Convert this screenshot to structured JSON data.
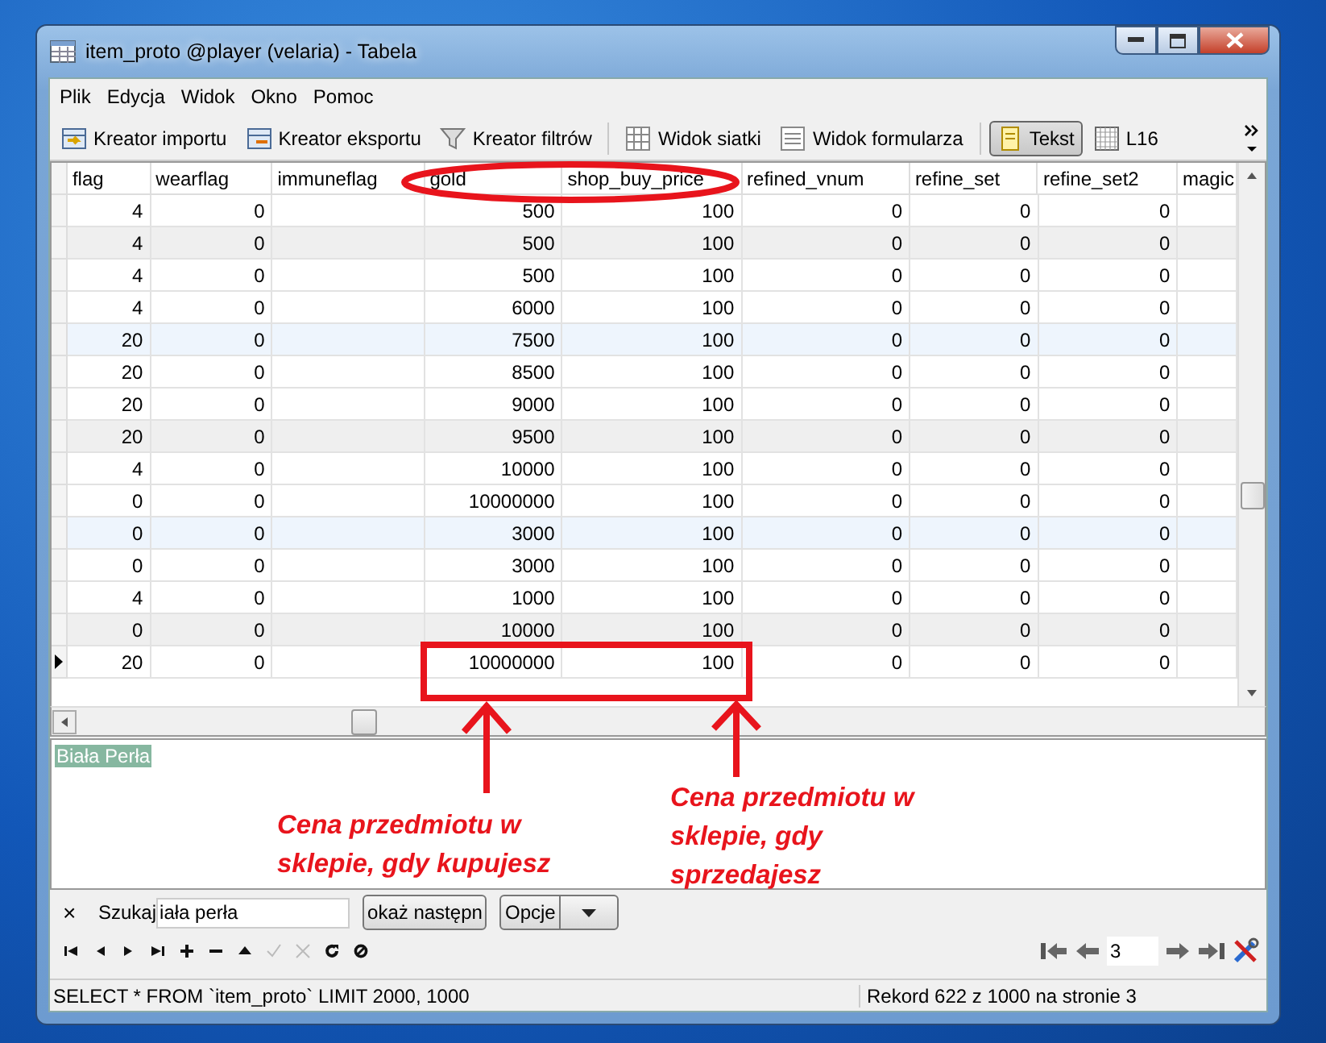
{
  "window": {
    "title": "item_proto @player (velaria) - Tabela"
  },
  "menu": [
    "Plik",
    "Edycja",
    "Widok",
    "Okno",
    "Pomoc"
  ],
  "toolbar": [
    {
      "kind": "import",
      "label": "Kreator importu",
      "selected": false
    },
    {
      "kind": "export",
      "label": "Kreator eksportu",
      "selected": false
    },
    {
      "kind": "filter",
      "label": "Kreator filtrów",
      "selected": false
    },
    {
      "kind": "grid",
      "label": "Widok siatki",
      "selected": false
    },
    {
      "kind": "form",
      "label": "Widok formularza",
      "selected": false
    },
    {
      "kind": "text",
      "label": "Tekst",
      "selected": true
    },
    {
      "kind": "hex",
      "label": "L16",
      "selected": false
    }
  ],
  "table": {
    "columns": [
      "flag",
      "wearflag",
      "immuneflag",
      "gold",
      "shop_buy_price",
      "refined_vnum",
      "refine_set",
      "refine_set2",
      "magic"
    ],
    "rows": [
      {
        "cells": [
          "4",
          "0",
          null,
          "500",
          "100",
          "0",
          "0",
          "0",
          null
        ],
        "selected": false
      },
      {
        "cells": [
          "4",
          "0",
          null,
          "500",
          "100",
          "0",
          "0",
          "0",
          null
        ],
        "selected": false
      },
      {
        "cells": [
          "4",
          "0",
          null,
          "500",
          "100",
          "0",
          "0",
          "0",
          null
        ],
        "selected": false
      },
      {
        "cells": [
          "4",
          "0",
          null,
          "6000",
          "100",
          "0",
          "0",
          "0",
          null
        ],
        "selected": false
      },
      {
        "cells": [
          "20",
          "0",
          null,
          "7500",
          "100",
          "0",
          "0",
          "0",
          null
        ],
        "selected": false
      },
      {
        "cells": [
          "20",
          "0",
          null,
          "8500",
          "100",
          "0",
          "0",
          "0",
          null
        ],
        "selected": false
      },
      {
        "cells": [
          "20",
          "0",
          null,
          "9000",
          "100",
          "0",
          "0",
          "0",
          null
        ],
        "selected": false
      },
      {
        "cells": [
          "20",
          "0",
          null,
          "9500",
          "100",
          "0",
          "0",
          "0",
          null
        ],
        "selected": false
      },
      {
        "cells": [
          "4",
          "0",
          null,
          "10000",
          "100",
          "0",
          "0",
          "0",
          null
        ],
        "selected": false
      },
      {
        "cells": [
          "0",
          "0",
          null,
          "10000000",
          "100",
          "0",
          "0",
          "0",
          null
        ],
        "selected": false
      },
      {
        "cells": [
          "0",
          "0",
          null,
          "3000",
          "100",
          "0",
          "0",
          "0",
          null
        ],
        "selected": false
      },
      {
        "cells": [
          "0",
          "0",
          null,
          "3000",
          "100",
          "0",
          "0",
          "0",
          null
        ],
        "selected": false
      },
      {
        "cells": [
          "4",
          "0",
          null,
          "1000",
          "100",
          "0",
          "0",
          "0",
          null
        ],
        "selected": false
      },
      {
        "cells": [
          "0",
          "0",
          null,
          "10000",
          "100",
          "0",
          "0",
          "0",
          null
        ],
        "selected": false
      },
      {
        "cells": [
          "20",
          "0",
          null,
          "10000000",
          "100",
          "0",
          "0",
          "0",
          null
        ],
        "selected": true
      }
    ]
  },
  "memo": {
    "text": "Biała Perła"
  },
  "search": {
    "close": "×",
    "label": "Szukaj",
    "value": "iała perła",
    "next_button": "okaż następn",
    "options_button": "Opcje"
  },
  "record_nav": [
    {
      "kind": "first",
      "disabled": false
    },
    {
      "kind": "prev",
      "disabled": false
    },
    {
      "kind": "next",
      "disabled": false
    },
    {
      "kind": "last",
      "disabled": false
    },
    {
      "kind": "add",
      "disabled": false
    },
    {
      "kind": "delete",
      "disabled": false
    },
    {
      "kind": "up",
      "disabled": false
    },
    {
      "kind": "post",
      "disabled": true
    },
    {
      "kind": "cancel",
      "disabled": true
    },
    {
      "kind": "refresh",
      "disabled": false
    },
    {
      "kind": "stop",
      "disabled": false
    }
  ],
  "page_nav": {
    "page": "3"
  },
  "status_bar": {
    "query": "SELECT * FROM `item_proto` LIMIT 2000, 1000",
    "record": "Rekord 622 z 1000 na stronie 3"
  },
  "annotations": {
    "buy_note": "Cena przedmiotu w sklepie, gdy kupujesz",
    "sell_note": "Cena przedmiotu w sklepie, gdy sprzedajesz"
  }
}
